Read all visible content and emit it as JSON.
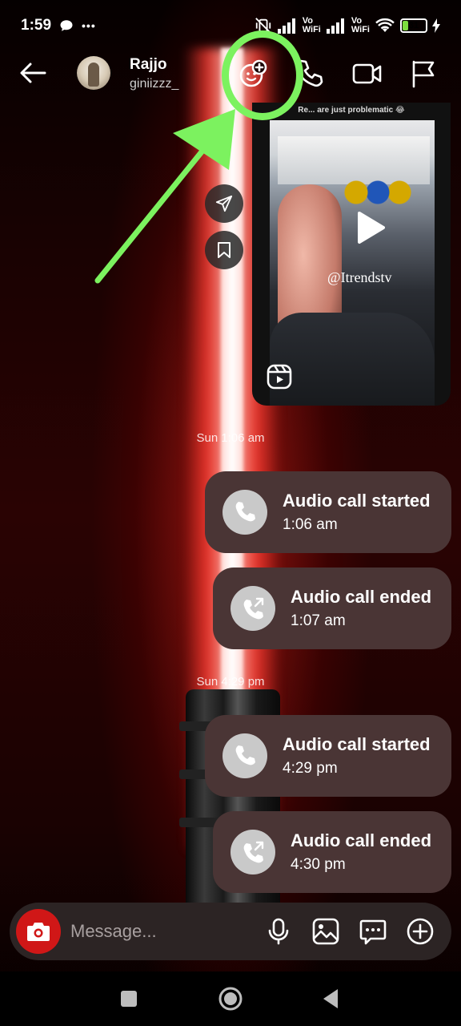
{
  "status_bar": {
    "time": "1:59",
    "dots": "•••",
    "volte1_top": "Vo",
    "volte1_bottom": "WiFi",
    "volte2_top": "Vo",
    "volte2_bottom": "WiFi",
    "battery_level": "31",
    "battery_fraction": 0.31,
    "battery_color": "#7ddc3f"
  },
  "header": {
    "contact_name": "Rajjo",
    "contact_username": "giniizzz_",
    "icons": [
      "back-arrow-icon",
      "effects-icon",
      "phone-icon",
      "video-call-icon",
      "flag-icon"
    ]
  },
  "annotation": {
    "color": "#7cf25f"
  },
  "reel": {
    "caption": "Re... are just problematic 😂",
    "watermark": "@Itrendstv",
    "icons": [
      "play-icon",
      "reels-icon",
      "share-icon",
      "bookmark-icon"
    ]
  },
  "messages": [
    {
      "type": "timestamp",
      "text": "Sun 1:06 am"
    },
    {
      "type": "call",
      "title": "Audio call started",
      "time": "1:06 am",
      "icon": "phone-icon"
    },
    {
      "type": "call",
      "title": "Audio call ended",
      "time": "1:07 am",
      "icon": "phone-outgoing-icon"
    },
    {
      "type": "timestamp",
      "text": "Sun 4:29 pm"
    },
    {
      "type": "call",
      "title": "Audio call started",
      "time": "4:29 pm",
      "icon": "phone-icon"
    },
    {
      "type": "call",
      "title": "Audio call ended",
      "time": "4:30 pm",
      "icon": "phone-outgoing-icon"
    }
  ],
  "composer": {
    "placeholder": "Message...",
    "icons": [
      "camera-icon",
      "microphone-icon",
      "gallery-icon",
      "sticker-icon",
      "plus-icon"
    ],
    "camera_color": "#d01717"
  },
  "colors": {
    "bubble": "#4a3535",
    "composer_bg": "#2c2424"
  }
}
